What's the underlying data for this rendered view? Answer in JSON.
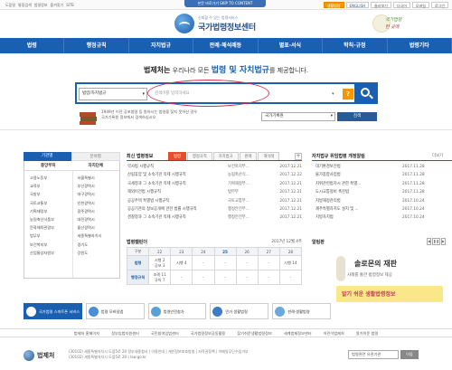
{
  "topbar": {
    "left_links": [
      "도움말",
      "통합검색",
      "법령정보",
      "즐겨찾기",
      "SITE"
    ],
    "skip_link": "본문 바로가기 SKIP TO CONTENT",
    "right_links": [
      "생활법령",
      "ENGLISH",
      "둘러보기",
      "다국어",
      "모바일",
      "로그인"
    ]
  },
  "logo": {
    "slogan": "신뢰할 수 있는 법령서비스",
    "name": "국가법령정보센터"
  },
  "badge": {
    "line1": "국가법령",
    "line2": "한 곳에"
  },
  "gnb": [
    "법령",
    "행정규칙",
    "자치법규",
    "판례·해석례등",
    "별표·서식",
    "학칙·규정",
    "법령기타"
  ],
  "headline": {
    "brand": "법제처는",
    "pre": "우리나라 모든",
    "highlight": "법령 및 자치법규",
    "post": "를 제공합니다."
  },
  "search": {
    "scope": "법령/자치법규",
    "placeholder": "검색어를 입력하세요",
    "help": "?"
  },
  "old_law": {
    "line1": "1949년 이전 공포법령 등 원하시는 법령을 찾지 못하신 경우",
    "line2": "국가기록원 정보에서 검색하십시오"
  },
  "law_sites": {
    "select": "국가기록원",
    "go": "검색"
  },
  "left_panel": {
    "tabs": [
      "기관별",
      "분야별"
    ],
    "headers": [
      "중앙부처",
      "자치단체"
    ],
    "col1": [
      "고용노동부",
      "교육부",
      "국방부",
      "국토교통부",
      "기획재정부",
      "농림축산식품부",
      "문화체육관광부",
      "법무부",
      "보건복지부",
      "산업통상자원부"
    ],
    "col2": [
      "서울특별시",
      "부산광역시",
      "대구광역시",
      "인천광역시",
      "광주광역시",
      "대전광역시",
      "울산광역시",
      "세종특별자치시",
      "경기도",
      "강원도"
    ]
  },
  "latest": {
    "title": "최신 법령정보",
    "tabs": [
      "법령",
      "행정규칙",
      "자치법규",
      "판례",
      "해석례"
    ],
    "rows": [
      {
        "title": "약사법 시행규칙",
        "org": "보건복지부...",
        "date": "2017.12.21"
      },
      {
        "title": "산림휴양 및 소속기관 직제 시행규칙",
        "org": "농림축산식...",
        "date": "2017.12.22"
      },
      {
        "title": "국세청과 그 소속기관 직제 시행규칙",
        "org": "기획재정부...",
        "date": "2017.12.21"
      },
      {
        "title": "해외이전법 시행규칙",
        "org": "법무부",
        "date": "2017.12.21"
      },
      {
        "title": "공공주택 특별법 시행규칙",
        "org": "국토교통부...",
        "date": "2017.12.21"
      },
      {
        "title": "공공기관의 정보공개에 관한 법률 시행규칙",
        "org": "행정안전부...",
        "date": "2017.12.21"
      },
      {
        "title": "경찰청과 그 소속기관 직제 시행규칙",
        "org": "행정안전부...",
        "date": "2017.12.21"
      }
    ]
  },
  "calendar": {
    "title": "법령캘린더",
    "date": "2017년 12월 4주",
    "header": [
      "구분",
      "22",
      "23",
      "24",
      "25",
      "26",
      "27",
      "28"
    ],
    "rows": [
      {
        "label": "법령",
        "cells": [
          "시행 2\n공포 3",
          "시행 4",
          "-",
          "-",
          "-",
          "-",
          "시행 14"
        ]
      },
      {
        "label": "행정규칙",
        "cells": [
          "조례 11\n규칙 7",
          "-",
          "-",
          "-",
          "-",
          "-",
          "-"
        ]
      }
    ]
  },
  "right_panel": {
    "title": "자치법규 위임법령 개정알림",
    "more": "더보기",
    "rows": [
      {
        "title": "대기환경보전법",
        "date": "2017.11.28"
      },
      {
        "title": "물가종합사업법",
        "date": "2017.11.28"
      },
      {
        "title": "지위관련법지시 관한 특별...",
        "date": "2017.11.28"
      },
      {
        "title": "도시교통정비 촉진법",
        "date": "2017.11.28"
      },
      {
        "title": "지방재정관리법",
        "date": "2017.10.24"
      },
      {
        "title": "제주특별자치도 설치 및 ...",
        "date": "2017.10.24"
      },
      {
        "title": "지방자치법",
        "date": "2017.10.24"
      }
    ]
  },
  "popup": {
    "title": "알림판",
    "banner_title": "솔로몬의 재판",
    "banner_sub": "사례를 통한 법령정보 제공",
    "banner2": "알기 쉬운 생활법령정보"
  },
  "quick": [
    "국가법령 스마트폰 서비스",
    "법령 모바일앱",
    "법령안전참가",
    "민가 생활법령",
    "판례·생활법령"
  ],
  "footer_links": [
    "법제처 홈페이지",
    "정부입법지원센터",
    "국민참여입법센터",
    "국가법령정보공동활용",
    "찾기쉬운생활법령정보",
    "세계법제정보센터",
    "어린이법제처",
    "알기쉬운 법령"
  ],
  "footer": {
    "brand": "법제처",
    "addr1": "(30102) 세종특별자치시 도움5로 20 정부세종청사 | 이용안내 | 개인정보보호방침 | 저작권정책 | 이메일무단수집거부",
    "addr2": "(30102) 세종특별자치시 도움5로 20 | law.go.kr",
    "select": "법령관련 유관기관",
    "go": "이동"
  },
  "colors": {
    "primary": "#1b5fb0",
    "accent_orange": "#f39800",
    "tab_active": "#e44e2a",
    "highlight_ring": "#d6334f"
  }
}
